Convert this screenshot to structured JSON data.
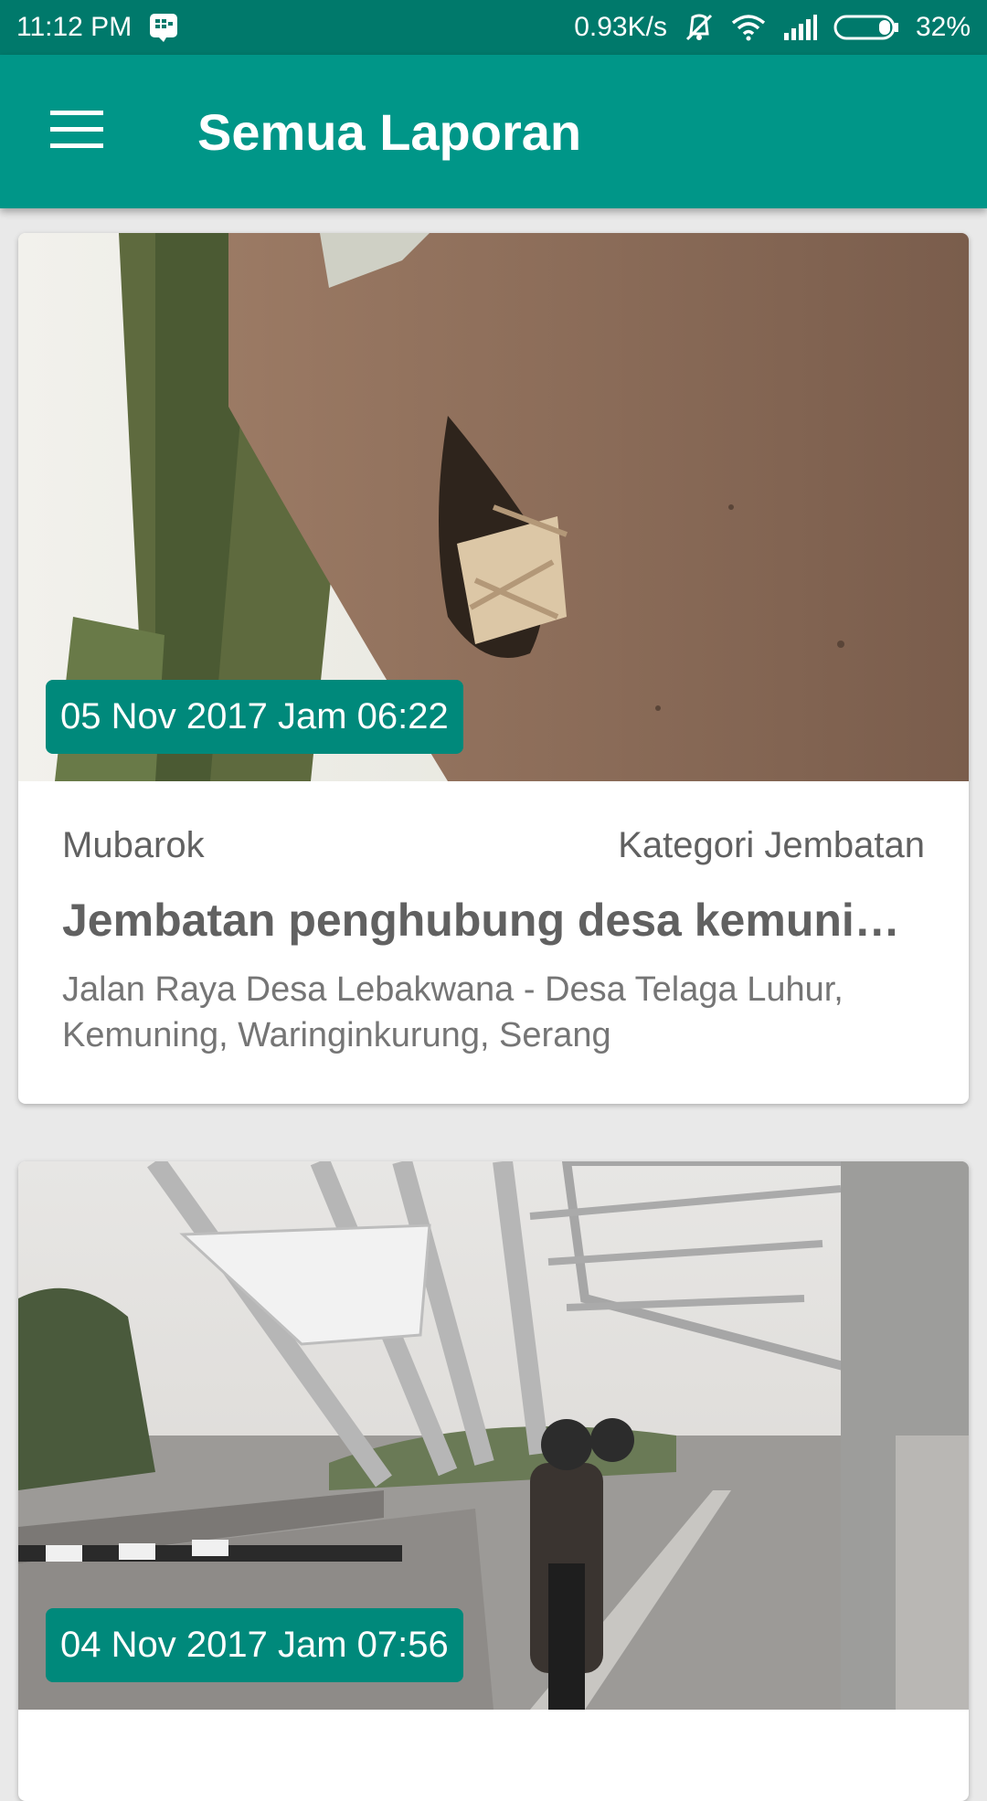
{
  "status_bar": {
    "time": "11:12 PM",
    "net_speed": "0.93K/s",
    "battery": "32%",
    "icons": [
      "bbm-notification-icon",
      "vibrate-off-icon",
      "wifi-icon",
      "signal-icon",
      "battery-icon"
    ]
  },
  "app_bar": {
    "title": "Semua Laporan",
    "menu_icon": "hamburger-menu-icon",
    "color": "#009688"
  },
  "reports": [
    {
      "date_label": "05 Nov 2017 Jam 06:22",
      "reporter": "Mubarok",
      "category": "Kategori Jembatan",
      "title": "Jembatan penghubung desa kemuning…",
      "location": "Jalan Raya Desa Lebakwana - Desa Telaga Luhur, Kemuning, Waringinkurung, Serang"
    },
    {
      "date_label": "04 Nov 2017 Jam 07:56"
    }
  ],
  "colors": {
    "primary": "#009688",
    "primary_dark": "#00796b",
    "badge": "#00897b"
  }
}
